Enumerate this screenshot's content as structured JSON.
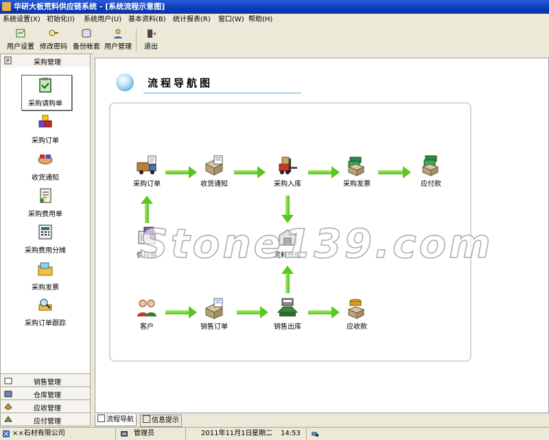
{
  "window": {
    "title": "华研大板荒料供应链系统 - [系统流程示意图]"
  },
  "menu": [
    {
      "label": "系统设置(X)"
    },
    {
      "label": "初始化(I)"
    },
    {
      "label": "系统用户(U)"
    },
    {
      "label": "基本资料(B)"
    },
    {
      "label": "统计报表(R)"
    },
    {
      "label": "窗口(W)"
    },
    {
      "label": "帮助(H)"
    }
  ],
  "toolbar": [
    {
      "label": "用户设置",
      "icon": "user-settings-icon"
    },
    {
      "label": "修改密码",
      "icon": "change-password-icon"
    },
    {
      "label": "备份帐套",
      "icon": "backup-icon"
    },
    {
      "label": "用户管理",
      "icon": "user-management-icon"
    },
    {
      "label": "退出",
      "icon": "exit-icon"
    }
  ],
  "sidebar": {
    "header": "采购管理",
    "items": [
      {
        "label": "采购请购单",
        "icon": "clipboard-check-icon",
        "selected": true
      },
      {
        "label": "采购订单",
        "icon": "cubes-icon"
      },
      {
        "label": "收货通知",
        "icon": "handshake-icon"
      },
      {
        "label": "采购费用单",
        "icon": "invoice-icon"
      },
      {
        "label": "采购费用分摊",
        "icon": "calculator-icon"
      },
      {
        "label": "采购发票",
        "icon": "folder-icon"
      },
      {
        "label": "采购订单跟踪",
        "icon": "track-icon"
      }
    ],
    "sections": [
      {
        "label": "销售管理",
        "icon": "sales-icon"
      },
      {
        "label": "仓库管理",
        "icon": "warehouse-icon"
      },
      {
        "label": "应收管理",
        "icon": "receivable-icon"
      },
      {
        "label": "应付管理",
        "icon": "payable-icon"
      }
    ]
  },
  "flow": {
    "title": "流程导航图",
    "nodes": [
      {
        "label": "采购订单",
        "icon": "delivery-truck-icon"
      },
      {
        "label": "收货通知",
        "icon": "package-doc-icon"
      },
      {
        "label": "采购入库",
        "icon": "forklift-icon"
      },
      {
        "label": "采购发票",
        "icon": "money-stack-icon"
      },
      {
        "label": "应付款",
        "icon": "money-boxes-icon"
      },
      {
        "label": "供应商",
        "icon": "supplier-icon"
      },
      {
        "label": "荒料仓库",
        "icon": "warehouse-icon"
      },
      {
        "label": "客户",
        "icon": "customers-icon"
      },
      {
        "label": "销售订单",
        "icon": "sales-order-icon"
      },
      {
        "label": "销售出库",
        "icon": "outbound-icon"
      },
      {
        "label": "应收款",
        "icon": "coins-box-icon"
      }
    ],
    "watermark": "Stone139.com"
  },
  "tabs": [
    {
      "label": "流程导航",
      "active": true
    },
    {
      "label": "信息提示",
      "active": false
    }
  ],
  "status": {
    "company": "××石材有限公司",
    "user": "管理员",
    "date": "2011年11月1日",
    "weekday": "星期二",
    "time": "14:53"
  }
}
